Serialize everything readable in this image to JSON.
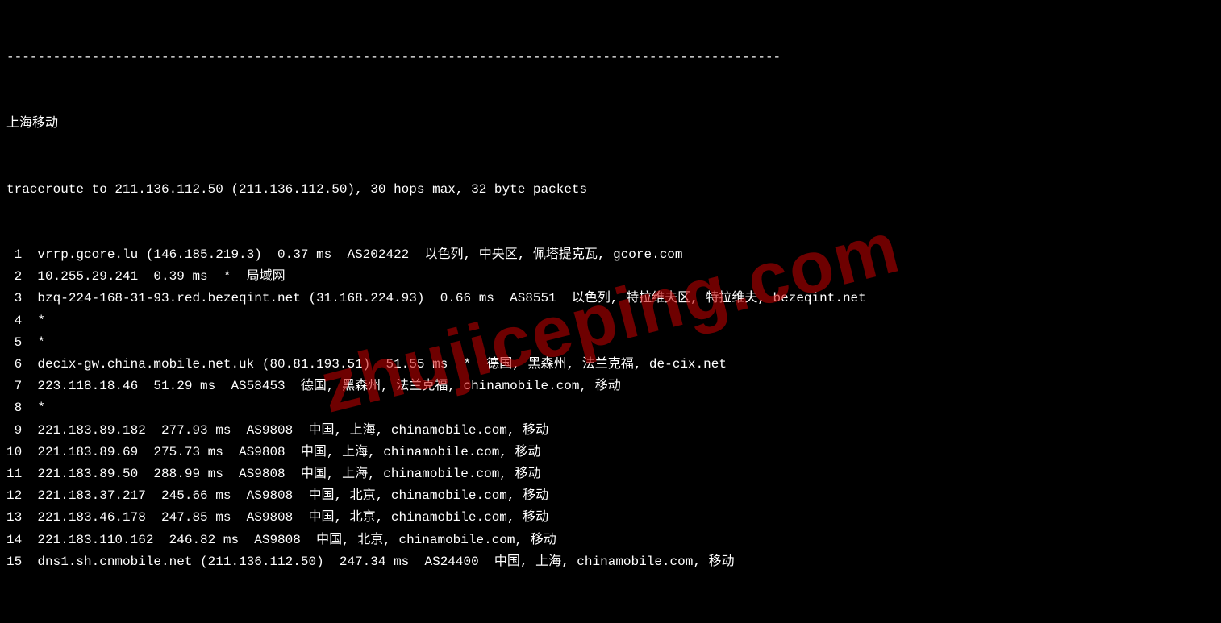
{
  "dashes": "----------------------------------------------------------------------------------------------------",
  "header": "上海移动",
  "cmdline": "traceroute to 211.136.112.50 (211.136.112.50), 30 hops max, 32 byte packets",
  "watermark": "zhujiceping.com",
  "hops": [
    {
      "n": " 1",
      "body": "vrrp.gcore.lu (146.185.219.3)  0.37 ms  AS202422  以色列, 中央区, 佩塔提克瓦, gcore.com"
    },
    {
      "n": " 2",
      "body": "10.255.29.241  0.39 ms  *  局域网"
    },
    {
      "n": " 3",
      "body": "bzq-224-168-31-93.red.bezeqint.net (31.168.224.93)  0.66 ms  AS8551  以色列, 特拉维夫区, 特拉维夫, bezeqint.net"
    },
    {
      "n": " 4",
      "body": "*"
    },
    {
      "n": " 5",
      "body": "*"
    },
    {
      "n": " 6",
      "body": "decix-gw.china.mobile.net.uk (80.81.193.51)  51.55 ms  *  德国, 黑森州, 法兰克福, de-cix.net"
    },
    {
      "n": " 7",
      "body": "223.118.18.46  51.29 ms  AS58453  德国, 黑森州, 法兰克福, chinamobile.com, 移动"
    },
    {
      "n": " 8",
      "body": "*"
    },
    {
      "n": " 9",
      "body": "221.183.89.182  277.93 ms  AS9808  中国, 上海, chinamobile.com, 移动"
    },
    {
      "n": "10",
      "body": "221.183.89.69  275.73 ms  AS9808  中国, 上海, chinamobile.com, 移动"
    },
    {
      "n": "11",
      "body": "221.183.89.50  288.99 ms  AS9808  中国, 上海, chinamobile.com, 移动"
    },
    {
      "n": "12",
      "body": "221.183.37.217  245.66 ms  AS9808  中国, 北京, chinamobile.com, 移动"
    },
    {
      "n": "13",
      "body": "221.183.46.178  247.85 ms  AS9808  中国, 北京, chinamobile.com, 移动"
    },
    {
      "n": "14",
      "body": "221.183.110.162  246.82 ms  AS9808  中国, 北京, chinamobile.com, 移动"
    },
    {
      "n": "15",
      "body": "dns1.sh.cnmobile.net (211.136.112.50)  247.34 ms  AS24400  中国, 上海, chinamobile.com, 移动"
    }
  ]
}
